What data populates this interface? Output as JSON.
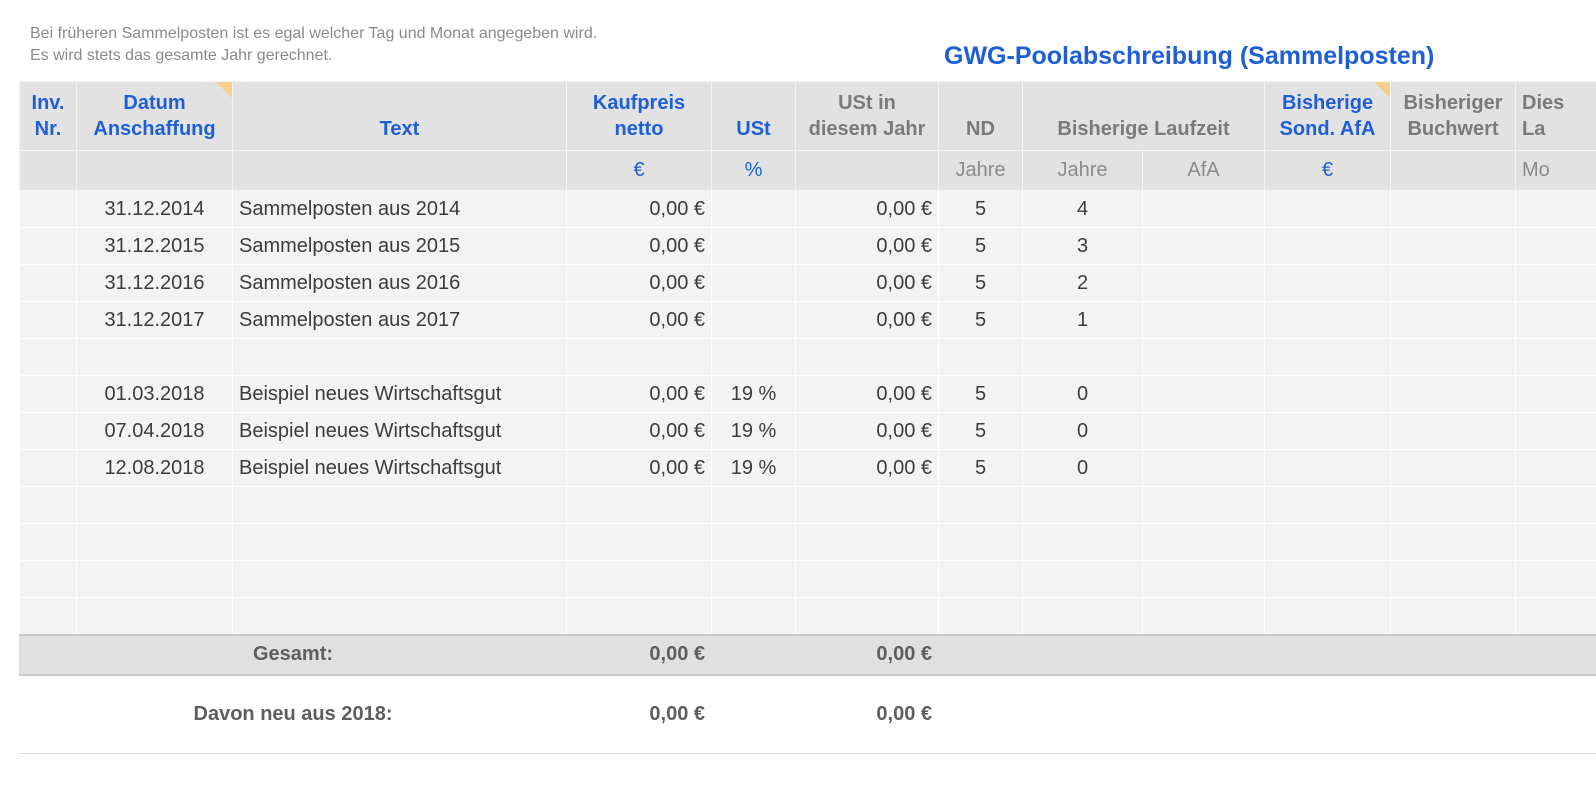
{
  "notes": {
    "line1": "Bei früheren Sammelposten ist es egal welcher Tag und Monat angegeben wird.",
    "line2": "Es wird stets das gesamte Jahr gerechnet."
  },
  "title": "GWG-Poolabschreibung (Sammelposten)",
  "headers": {
    "inv_l1": "Inv.",
    "inv_l2": "Nr.",
    "datum_l1": "Datum",
    "datum_l2": "Anschaffung",
    "text": "Text",
    "kauf_l1": "Kaufpreis",
    "kauf_l2": "netto",
    "ust": "USt",
    "ustjahr_l1": "USt in",
    "ustjahr_l2": "diesem Jahr",
    "nd": "ND",
    "laufzeit": "Bisherige Laufzeit",
    "sond_l1": "Bisherige",
    "sond_l2": "Sond. AfA",
    "buch_l1": "Bisheriger",
    "buch_l2": "Buchwert",
    "dies_l1": "Dies",
    "dies_l2": "La"
  },
  "units": {
    "kauf": "€",
    "ust": "%",
    "nd": "Jahre",
    "laufzeit_jahre": "Jahre",
    "laufzeit_afa": "AfA",
    "sond": "€",
    "dies": "Mo"
  },
  "rows": [
    {
      "datum": "31.12.2014",
      "text": "Sammelposten aus 2014",
      "kauf": "0,00 €",
      "ust": "",
      "ustjahr": "0,00 €",
      "nd": "5",
      "jahre": "4"
    },
    {
      "datum": "31.12.2015",
      "text": "Sammelposten aus 2015",
      "kauf": "0,00 €",
      "ust": "",
      "ustjahr": "0,00 €",
      "nd": "5",
      "jahre": "3"
    },
    {
      "datum": "31.12.2016",
      "text": "Sammelposten aus 2016",
      "kauf": "0,00 €",
      "ust": "",
      "ustjahr": "0,00 €",
      "nd": "5",
      "jahre": "2"
    },
    {
      "datum": "31.12.2017",
      "text": "Sammelposten aus 2017",
      "kauf": "0,00 €",
      "ust": "",
      "ustjahr": "0,00 €",
      "nd": "5",
      "jahre": "1"
    },
    {
      "datum": "",
      "text": "",
      "kauf": "",
      "ust": "",
      "ustjahr": "",
      "nd": "",
      "jahre": ""
    },
    {
      "datum": "01.03.2018",
      "text": "Beispiel neues Wirtschaftsgut",
      "kauf": "0,00 €",
      "ust": "19 %",
      "ustjahr": "0,00 €",
      "nd": "5",
      "jahre": "0"
    },
    {
      "datum": "07.04.2018",
      "text": "Beispiel neues Wirtschaftsgut",
      "kauf": "0,00 €",
      "ust": "19 %",
      "ustjahr": "0,00 €",
      "nd": "5",
      "jahre": "0"
    },
    {
      "datum": "12.08.2018",
      "text": "Beispiel neues Wirtschaftsgut",
      "kauf": "0,00 €",
      "ust": "19 %",
      "ustjahr": "0,00 €",
      "nd": "5",
      "jahre": "0"
    },
    {
      "datum": "",
      "text": "",
      "kauf": "",
      "ust": "",
      "ustjahr": "",
      "nd": "",
      "jahre": ""
    },
    {
      "datum": "",
      "text": "",
      "kauf": "",
      "ust": "",
      "ustjahr": "",
      "nd": "",
      "jahre": ""
    },
    {
      "datum": "",
      "text": "",
      "kauf": "",
      "ust": "",
      "ustjahr": "",
      "nd": "",
      "jahre": ""
    },
    {
      "datum": "",
      "text": "",
      "kauf": "",
      "ust": "",
      "ustjahr": "",
      "nd": "",
      "jahre": ""
    }
  ],
  "total": {
    "label": "Gesamt:",
    "kauf": "0,00 €",
    "ustjahr": "0,00 €"
  },
  "davon": {
    "label": "Davon neu aus 2018:",
    "kauf": "0,00 €",
    "ustjahr": "0,00 €"
  },
  "colors": {
    "accent": "#1f5fd6",
    "header_bg": "#e2e2e2",
    "comment_marker": "#f8cf8a"
  }
}
